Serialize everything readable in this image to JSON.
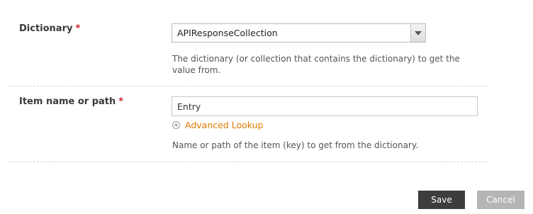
{
  "dictionary_field": {
    "label": "Dictionary",
    "required_marker": "*",
    "selected_value": "APIResponseCollection",
    "help_line1": "The dictionary (or collection that contains the dictionary) to get the",
    "help_line2": "value from."
  },
  "item_field": {
    "label": "Item name or path",
    "required_marker": "*",
    "value": "Entry",
    "advanced_lookup_label": "Advanced Lookup",
    "help": "Name or path of the item (key) to get from the dictionary."
  },
  "actions": {
    "save_label": "Save",
    "cancel_label": "Cancel"
  },
  "colors": {
    "required": "#c62828",
    "link": "#e07b00",
    "save_bg": "#3d3d3d",
    "cancel_bg": "#b5b5b5"
  },
  "icons": {
    "dropdown": "chevron-down-icon",
    "lookup": "plus-circle-icon"
  }
}
